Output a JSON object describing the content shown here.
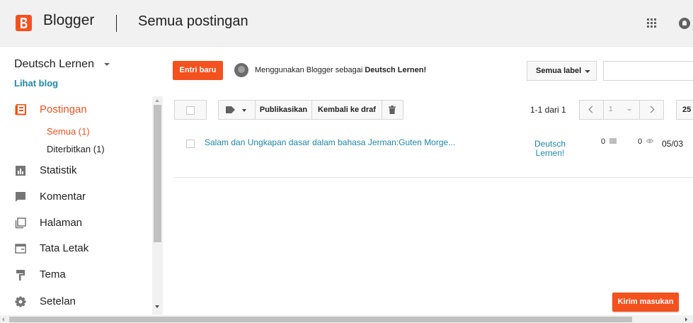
{
  "header": {
    "brand": "Blogger",
    "page_title": "Semua postingan",
    "icons": [
      "blogger-logo-icon",
      "apps-grid-icon",
      "notifications-icon"
    ]
  },
  "sidebar": {
    "blog_name": "Deutsch Lernen",
    "view_blog": "Lihat blog",
    "posts": {
      "label": "Postingan",
      "icon": "posts-icon",
      "sub": [
        {
          "label": "Semua (1)",
          "active": true
        },
        {
          "label": "Diterbitkan (1)",
          "active": false
        }
      ]
    },
    "items": [
      {
        "label": "Statistik",
        "icon": "stats-icon"
      },
      {
        "label": "Komentar",
        "icon": "comment-icon"
      },
      {
        "label": "Halaman",
        "icon": "pages-icon"
      },
      {
        "label": "Tata Letak",
        "icon": "layout-icon"
      },
      {
        "label": "Tema",
        "icon": "theme-icon"
      },
      {
        "label": "Setelan",
        "icon": "settings-icon"
      }
    ]
  },
  "topbar": {
    "new_post": "Entri baru",
    "using_prefix": "Menggunakan Blogger sebagai ",
    "using_blog": "Deutsch Lernen!",
    "label_filter": "Semua label",
    "search_placeholder": ""
  },
  "toolbar": {
    "publish": "Publikasikan",
    "revert": "Kembali ke draf",
    "pager": "1-1 dari 1",
    "page_select": "1",
    "per_page": "25"
  },
  "posts": [
    {
      "title": "Salam dan Ungkapan dasar dalam bahasa Jerman:Guten Morge...",
      "blog": "Deutsch Lernen!",
      "comments": "0",
      "views": "0",
      "date": "05/03"
    }
  ],
  "feedback": "Kirim masukan",
  "colors": {
    "accent": "#f4511e",
    "link": "#1e88a8",
    "header_bg": "#f1f1f1"
  }
}
